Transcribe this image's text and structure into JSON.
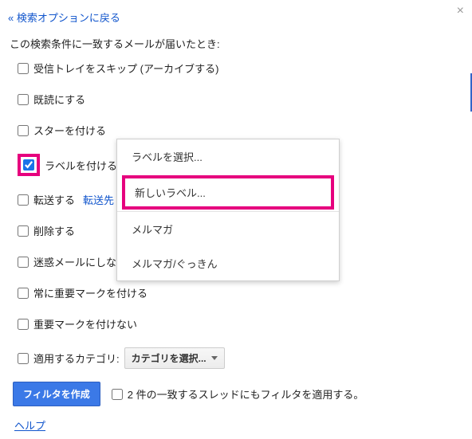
{
  "header": {
    "back_link": "« 検索オプションに戻る"
  },
  "intro": "この検索条件に一致するメールが届いたとき:",
  "options": {
    "skip_inbox": "受信トレイをスキップ (アーカイブする)",
    "mark_read": "既読にする",
    "star": "スターを付ける",
    "apply_label": "ラベルを付ける:",
    "forward": "転送する",
    "forward_link": "転送先",
    "delete": "削除する",
    "spam": "迷惑メールにしな",
    "always_important": "常に重要マークを付ける",
    "never_important": "重要マークを付けない",
    "apply_category": "適用するカテゴリ:"
  },
  "category_select": "カテゴリを選択...",
  "label_popup": {
    "choose": "ラベルを選択...",
    "new_label": "新しいラベル...",
    "item1": "メルマガ",
    "item2": "メルマガ/ぐっきん"
  },
  "footer": {
    "create_button": "フィルタを作成",
    "apply_existing": "2 件の一致するスレッドにもフィルタを適用する。"
  },
  "help": "ヘルプ"
}
